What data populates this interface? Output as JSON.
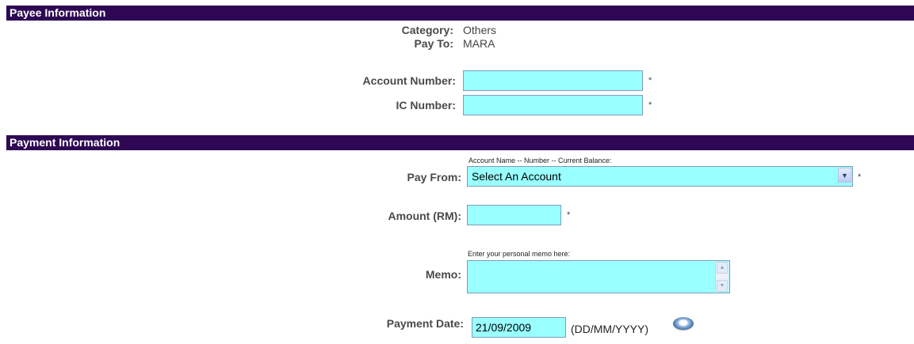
{
  "payee_section": {
    "header": "Payee Information",
    "category_label": "Category:",
    "category_value": "Others",
    "payto_label": "Pay To:",
    "payto_value": "MARA",
    "account_number_label": "Account Number:",
    "account_number_value": "",
    "ic_number_label": "IC Number:",
    "ic_number_value": "",
    "required_mark": "*"
  },
  "payment_section": {
    "header": "Payment Information",
    "payfrom_hint": "Account Name -- Number -- Current Balance:",
    "payfrom_label": "Pay From:",
    "payfrom_selected": "Select An Account",
    "amount_label": "Amount (RM):",
    "amount_value": "",
    "memo_hint": "Enter your personal memo here:",
    "memo_label": "Memo:",
    "memo_value": "",
    "payment_date_label": "Payment Date:",
    "payment_date_value": "21/09/2009",
    "date_format": "(DD/MM/YYYY)",
    "required_mark": "*"
  },
  "colors": {
    "header_bg": "#2e0854",
    "field_bg": "#99ffff",
    "field_border": "#7f9db9"
  },
  "icons": {
    "dropdown": "chevron-down-icon",
    "calendar": "calendar-icon"
  }
}
